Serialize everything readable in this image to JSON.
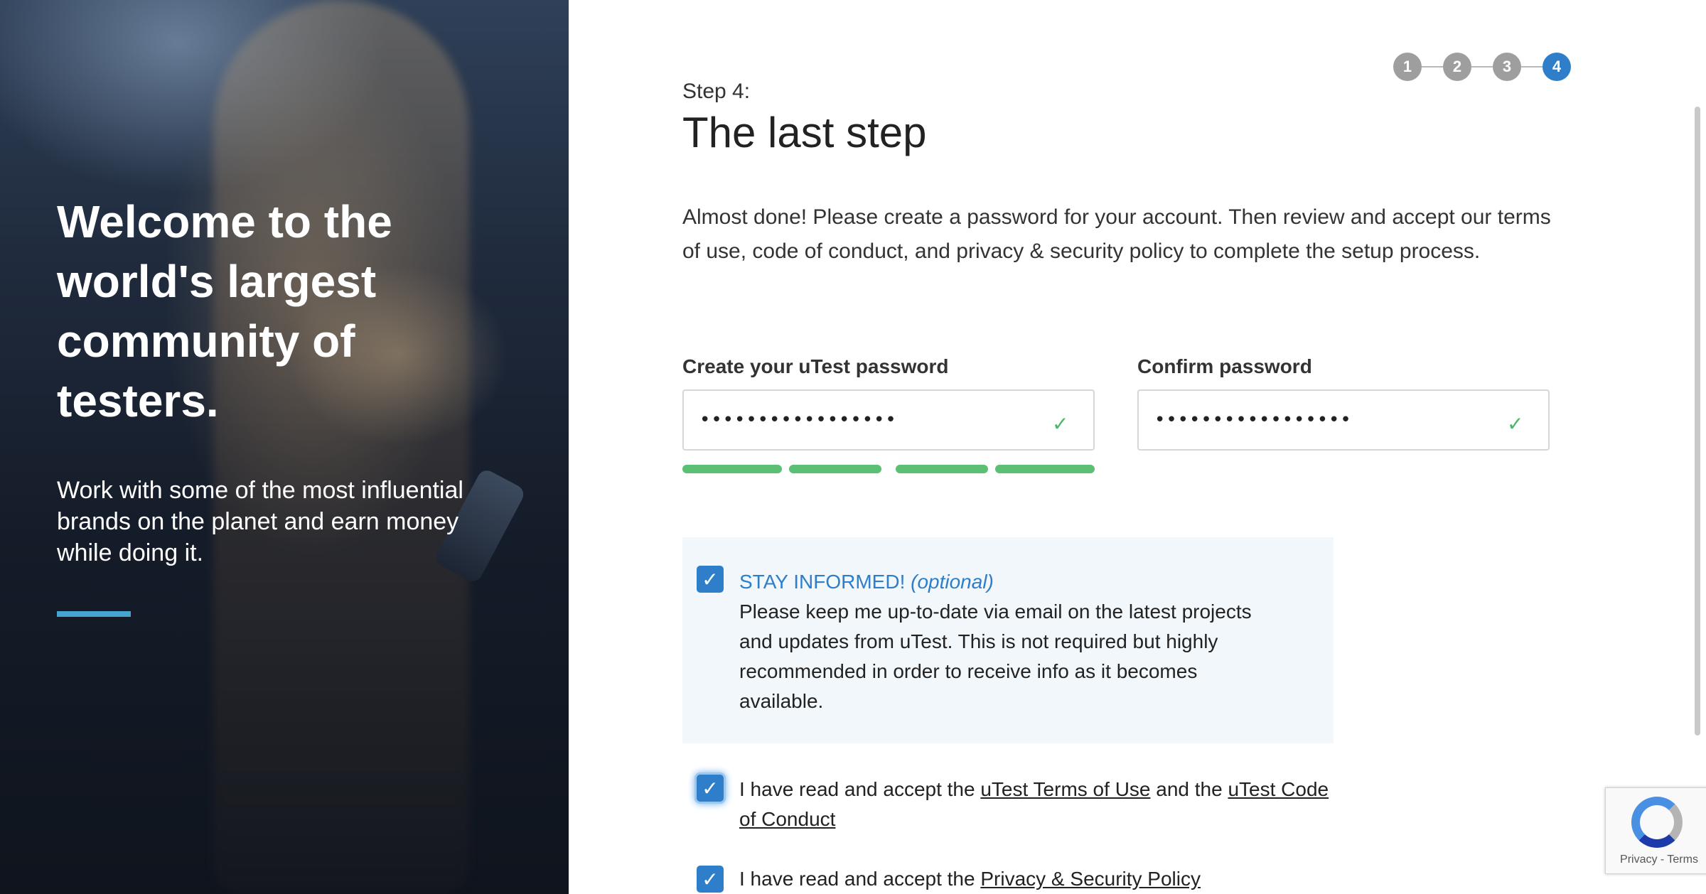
{
  "hero": {
    "title": "Welcome to the world's largest community of testers.",
    "subtitle": "Work with some of the most influential brands on the planet and earn money while doing it."
  },
  "stepper": {
    "steps": [
      "1",
      "2",
      "3",
      "4"
    ],
    "current": 4
  },
  "step_label": "Step 4:",
  "title": "The last step",
  "intro": "Almost done! Please create a password for your account. Then review and accept our terms of use, code of conduct, and privacy & security policy to complete the setup process.",
  "password": {
    "label": "Create your uTest password",
    "value": "•••••••••••••••••"
  },
  "confirm": {
    "label": "Confirm password",
    "value": "•••••••••••••••••"
  },
  "strength": {
    "filled_segments": 4,
    "total_segments": 4
  },
  "stay_informed": {
    "heading": "STAY INFORMED!",
    "optional": "(optional)",
    "text": "Please keep me up-to-date via email on the latest projects and updates from uTest. This is not required but highly recommended in order to receive info as it becomes available.",
    "checked": true
  },
  "terms": {
    "prefix": "I have read and accept the ",
    "link1": "uTest Terms of Use",
    "middle": " and the ",
    "link2": "uTest Code of Conduct",
    "checked": true
  },
  "privacy": {
    "prefix": "I have read and accept the ",
    "link": "Privacy & Security Policy",
    "checked": true
  },
  "recaptcha": {
    "privacy": "Privacy",
    "separator": " - ",
    "terms": "Terms"
  },
  "colors": {
    "accent": "#2f7ec9",
    "success": "#5bbf74",
    "hero_bar": "#49a3d1"
  }
}
